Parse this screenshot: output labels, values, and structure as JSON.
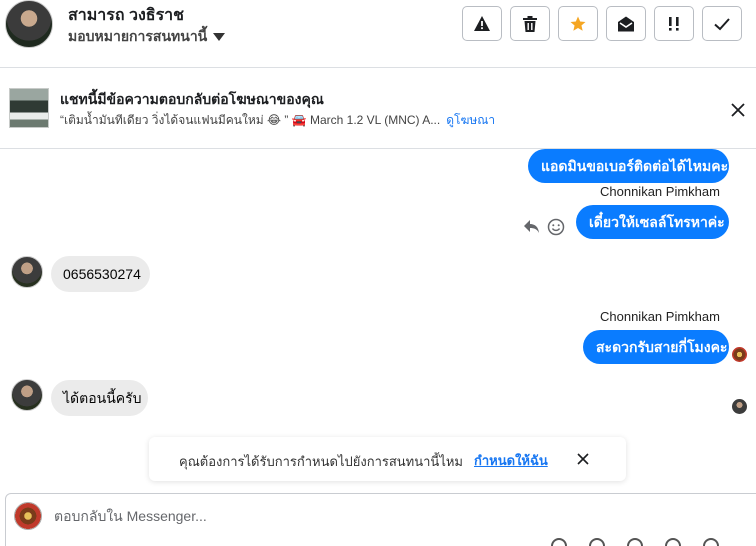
{
  "header": {
    "contact_name": "สามารถ วงธิราช",
    "assign_label": "มอบหมายการสนทนานี้",
    "tools": [
      {
        "icon": "warning-icon",
        "color": "#1c1e21"
      },
      {
        "icon": "trash-icon",
        "color": "#1c1e21"
      },
      {
        "icon": "star-icon",
        "color": "#f5a623"
      },
      {
        "icon": "envelope-open-icon",
        "color": "#1c1e21"
      },
      {
        "icon": "double-exclamation-icon",
        "color": "#1c1e21"
      },
      {
        "icon": "check-icon",
        "color": "#1c1e21"
      }
    ]
  },
  "ad_banner": {
    "title": "แชทนี้มีข้อความตอบกลับต่อโฆษณาของคุณ",
    "quote": "“เติมน้ำมันทีเดียว วิ่งได้จนแฟนมีคนใหม่ 😂 ” 🚘 March 1.2 VL (MNC) A...",
    "view_ad_label": "ดูโฆษณา"
  },
  "messages": {
    "out_1": "แอดมินขอเบอร์ติดต่อได้ไหมคะ",
    "sender_1": "Chonnikan Pimkham",
    "out_2": "เดี๋ยวให้เซลล์โทรหาค่ะ",
    "in_1": "0656530274",
    "sender_2": "Chonnikan Pimkham",
    "out_3": "สะดวกรับสายกี่โมงคะ",
    "in_2": "ได้ตอนนี้ครับ"
  },
  "suggestion": {
    "text": "คุณต้องการได้รับการกำหนดไปยังการสนทนานี้ไหม",
    "action_label": "กำหนดให้ฉัน"
  },
  "composer": {
    "placeholder": "ตอบกลับใน Messenger..."
  },
  "colors": {
    "accent": "#0a7cff",
    "link": "#1877f2",
    "incoming_bubble": "#ebebeb"
  }
}
